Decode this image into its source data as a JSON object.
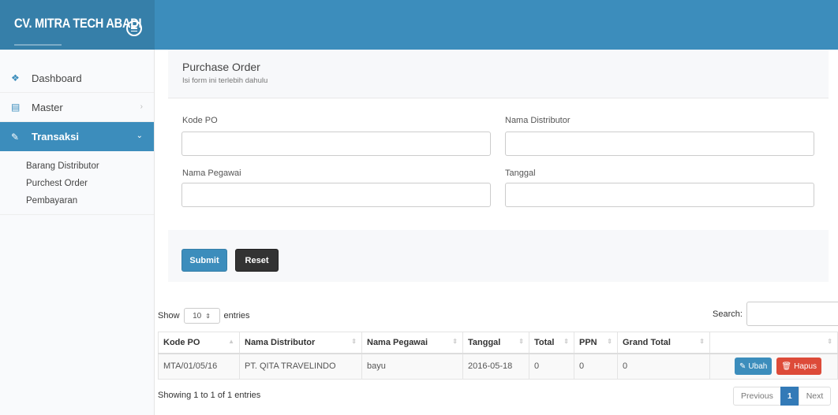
{
  "app": {
    "brand": "CV. MITRA TECH ABADI"
  },
  "sidebar": {
    "items": [
      {
        "label": "Dashboard",
        "icon": "home-icon"
      },
      {
        "label": "Master",
        "icon": "bank-icon"
      },
      {
        "label": "Transaksi",
        "icon": "edit-icon"
      }
    ],
    "submenu": [
      "Barang Distributor",
      "Purchest Order",
      "Pembayaran"
    ]
  },
  "form": {
    "title": "Purchase Order",
    "subtitle": "Isi form ini terlebih dahulu",
    "kode_po_label": "Kode PO",
    "nama_distributor_label": "Nama Distributor",
    "nama_pegawai_label": "Nama Pegawai",
    "tanggal_label": "Tanggal",
    "submit_label": "Submit",
    "reset_label": "Reset"
  },
  "table": {
    "show_label": "Show",
    "entries_value": "10",
    "entries_label": "entries",
    "search_label": "Search:",
    "columns": [
      "Kode PO",
      "Nama Distributor",
      "Nama Pegawai",
      "Tanggal",
      "Total",
      "PPN",
      "Grand Total",
      ""
    ],
    "rows": [
      {
        "kode_po": "MTA/01/05/16",
        "nama_distributor": "PT. QITA TRAVELINDO",
        "nama_pegawai": "bayu",
        "tanggal": "2016-05-18",
        "total": "0",
        "ppn": "0",
        "grand_total": "0"
      }
    ],
    "edit_label": "Ubah",
    "delete_label": "Hapus",
    "info": "Showing 1 to 1 of 1 entries",
    "pager": {
      "previous": "Previous",
      "current": "1",
      "next": "Next"
    }
  },
  "colors": {
    "primary": "#3c8dbc",
    "brand_dark": "#367fa9",
    "danger": "#dd4b39",
    "dark": "#333333"
  }
}
